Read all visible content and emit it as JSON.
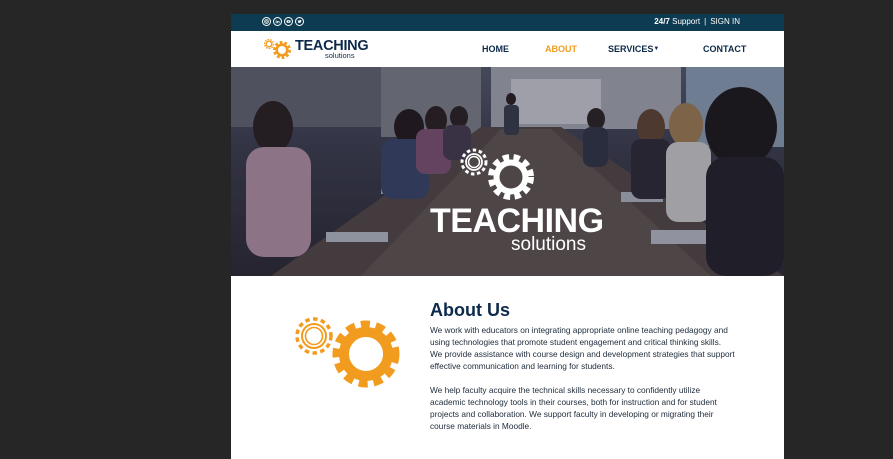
{
  "topbar": {
    "social_icons": [
      "instagram-icon",
      "linkedin-icon",
      "youtube-icon",
      "twitter-icon"
    ],
    "support_bold": "24/7",
    "support_label": "Support",
    "separator": "|",
    "signin_label": "SIGN IN"
  },
  "logo": {
    "word": "TEACHING",
    "sub": "solutions"
  },
  "nav": {
    "home": "HOME",
    "about": "ABOUT",
    "services": "SERVICES",
    "services_caret": "▼",
    "contact": "CONTACT"
  },
  "hero": {
    "logo_word": "TEACHING",
    "logo_sub": "solutions"
  },
  "about": {
    "title": "About Us",
    "paragraph_1": "We work with educators on integrating appropriate online teaching pedagogy and using technologies that promote student engagement and critical thinking skills. We provide assistance with course design and development strategies that support effective communication and learning for students.",
    "paragraph_2": "We help faculty acquire the technical skills necessary to confidently utilize academic technology tools in their courses, both for instruction and for student projects and collaboration. We support faculty in developing or migrating their course materials in Moodle."
  },
  "colors": {
    "page_bg": "#262626",
    "topbar_bg": "#0d3c52",
    "navy": "#0d2a4a",
    "accent_orange": "#f29c1f"
  }
}
